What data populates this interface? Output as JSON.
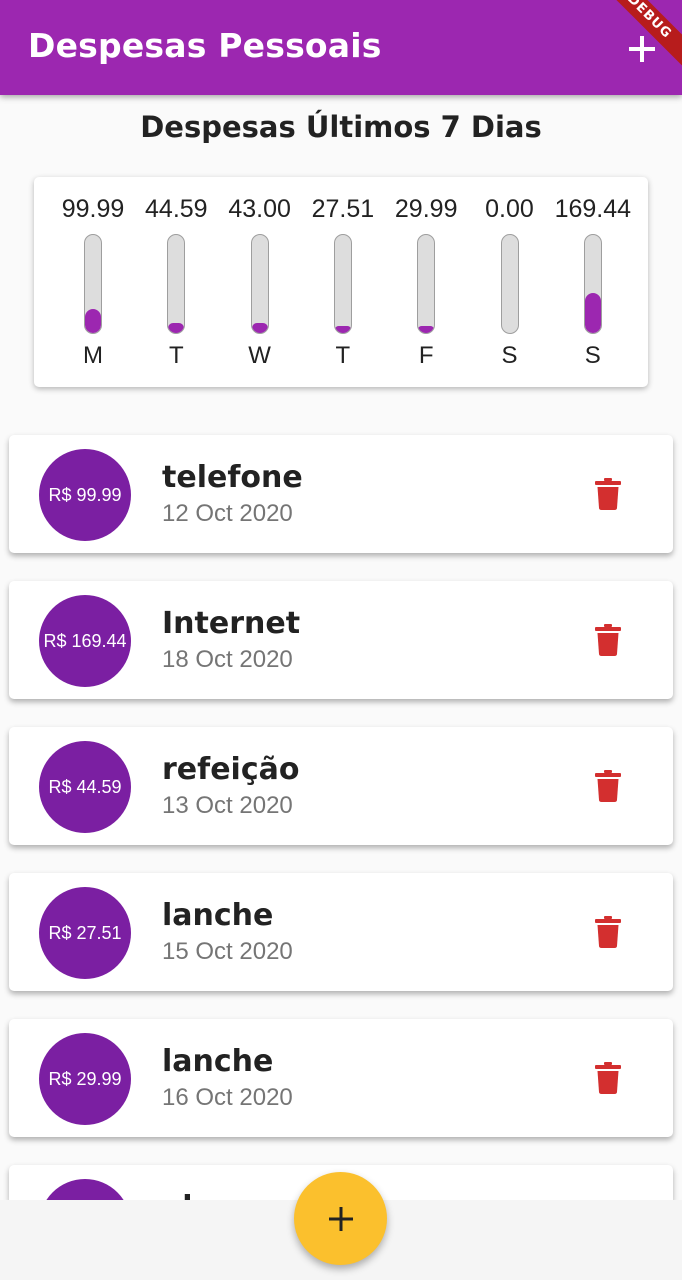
{
  "app_bar": {
    "title": "Despesas Pessoais",
    "add_icon": "plus-icon",
    "debug_banner": "DEBUG",
    "color": "#9c27b0"
  },
  "chart": {
    "title": "Despesas Últimos 7 Dias",
    "accent": "#9c27b0"
  },
  "chart_data": {
    "type": "bar",
    "categories": [
      "M",
      "T",
      "W",
      "T",
      "F",
      "S",
      "S"
    ],
    "value_labels": [
      "99.99",
      "44.59",
      "43.00",
      "27.51",
      "29.99",
      "0.00",
      "169.44"
    ],
    "values": [
      99.99,
      44.59,
      43.0,
      27.51,
      29.99,
      0.0,
      169.44
    ],
    "fill_fraction": [
      0.24,
      0.1,
      0.1,
      0.07,
      0.07,
      0.0,
      0.41
    ],
    "orientation": "vertical",
    "grid": false
  },
  "transactions": [
    {
      "amount_label": "R$ 99.99",
      "title": "telefone",
      "date": "12 Oct 2020",
      "delete_icon": "trash-icon"
    },
    {
      "amount_label": "R$ 169.44",
      "title": "Internet",
      "date": "18 Oct 2020",
      "delete_icon": "trash-icon"
    },
    {
      "amount_label": "R$ 44.59",
      "title": "refeição",
      "date": "13 Oct 2020",
      "delete_icon": "trash-icon"
    },
    {
      "amount_label": "R$ 27.51",
      "title": "lanche",
      "date": "15 Oct 2020",
      "delete_icon": "trash-icon"
    },
    {
      "amount_label": "R$ 29.99",
      "title": "lanche",
      "date": "16 Oct 2020",
      "delete_icon": "trash-icon"
    },
    {
      "amount_label": "",
      "title": "almoço",
      "date": "",
      "delete_icon": "trash-icon"
    }
  ],
  "fab": {
    "icon": "plus-icon",
    "color": "#fbc02d"
  },
  "colors": {
    "avatar": "#7b1fa2",
    "delete": "#d32f2f",
    "background": "#fafafa"
  }
}
